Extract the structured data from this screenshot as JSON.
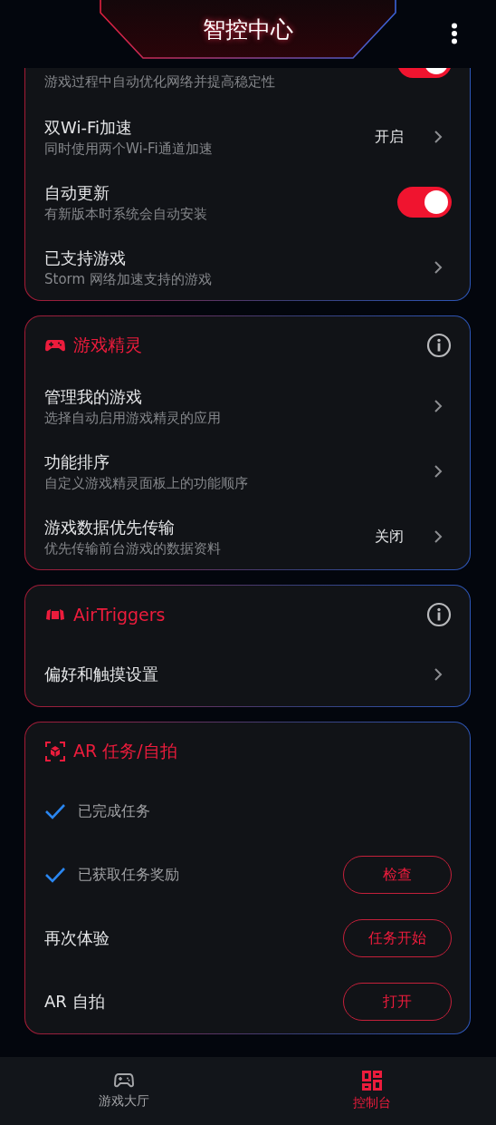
{
  "header": {
    "title": "智控中心"
  },
  "sections": [
    {
      "kind": "scrolled",
      "items": [
        {
          "kind": "partial-toggle",
          "subtitle": "游戏过程中自动优化网络并提高稳定性",
          "on": true
        },
        {
          "kind": "value",
          "title": "双Wi-Fi加速",
          "subtitle": "同时使用两个Wi-Fi通道加速",
          "value": "开启"
        },
        {
          "kind": "toggle",
          "title": "自动更新",
          "subtitle": "有新版本时系统会自动安装",
          "on": true
        },
        {
          "kind": "link",
          "title": "已支持游戏",
          "subtitle": "Storm 网络加速支持的游戏"
        }
      ]
    },
    {
      "kind": "gamepad",
      "title": "游戏精灵",
      "info": true,
      "items": [
        {
          "kind": "link",
          "title": "管理我的游戏",
          "subtitle": "选择自动启用游戏精灵的应用"
        },
        {
          "kind": "link",
          "title": "功能排序",
          "subtitle": "自定义游戏精灵面板上的功能顺序"
        },
        {
          "kind": "value",
          "title": "游戏数据优先传输",
          "subtitle": "优先传输前台游戏的数据资料",
          "value": "关闭"
        }
      ]
    },
    {
      "kind": "triggers",
      "title": "AirTriggers",
      "info": true,
      "items": [
        {
          "kind": "link",
          "title": "偏好和触摸设置"
        }
      ]
    },
    {
      "kind": "ar",
      "title": "AR 任务/自拍",
      "items": [
        {
          "kind": "check",
          "title": "已完成任务",
          "checked": true
        },
        {
          "kind": "check",
          "title": "已获取任务奖励",
          "checked": true,
          "button": "检查"
        },
        {
          "kind": "action",
          "title": "再次体验",
          "button": "任务开始"
        },
        {
          "kind": "action",
          "title": "AR 自拍",
          "button": "打开"
        }
      ]
    }
  ],
  "nav": [
    {
      "kind": "games",
      "label": "游戏大厅",
      "selected": false
    },
    {
      "kind": "console",
      "label": "控制台",
      "selected": true
    }
  ]
}
